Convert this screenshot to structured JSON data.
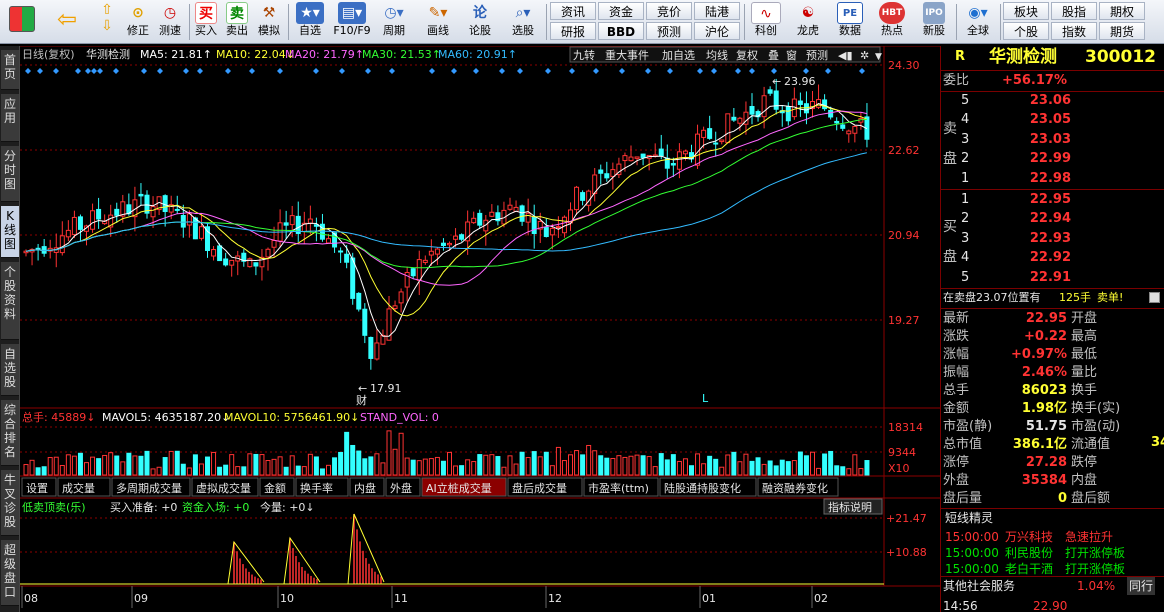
{
  "toolbar": {
    "buttons": [
      {
        "label": "修正"
      },
      {
        "label": "测速"
      },
      {
        "label": "买入"
      },
      {
        "label": "卖出"
      },
      {
        "label": "模拟"
      },
      {
        "label": "自选"
      },
      {
        "label": "F10/F9"
      },
      {
        "label": "周期"
      },
      {
        "label": "画线"
      },
      {
        "label": "论股"
      },
      {
        "label": "选股"
      },
      {
        "label": "科创"
      },
      {
        "label": "龙虎"
      },
      {
        "label": "数据"
      },
      {
        "label": "热点"
      },
      {
        "label": "新股"
      },
      {
        "label": "全球"
      }
    ],
    "grid1": [
      "资讯",
      "资金",
      "竞价",
      "陆港",
      "研报",
      "BBD",
      "预测",
      "沪伦"
    ],
    "grid2": [
      "板块",
      "股指",
      "期权",
      "个股",
      "指数",
      "期货"
    ],
    "buy_char": "买",
    "sell_char": "卖",
    "bbd": "BBD",
    "pe": "PE",
    "hbt": "HBT",
    "ipo": "IPO"
  },
  "sidetabs": [
    "首页",
    "应用",
    "分时图",
    "K线图",
    "个股资料",
    "自选股",
    "综合排名",
    "牛叉诊股",
    "超级盘口"
  ],
  "chart": {
    "header": {
      "period": "日线(复权)",
      "name": "华测检测",
      "ma5": "MA5: 21.81↑",
      "ma10": "MA10: 22.04↓",
      "ma20": "MA20: 21.79↑",
      "ma30": "MA30: 21.53↑",
      "ma60": "MA60: 20.91↑",
      "buttons": [
        "九转",
        "重大事件",
        "加自选",
        "均线",
        "复权",
        "叠",
        "窗",
        "预测"
      ]
    },
    "price_axis": [
      "24.30",
      "22.62",
      "20.94",
      "19.27"
    ],
    "high_label": "23.96",
    "low_label": "17.91",
    "fin_mark": "财",
    "l_mark": "L",
    "volume_header": {
      "total": "总手: 45889↓",
      "mavol5": "MAVOL5: 4635187.20↓",
      "mavol10": "MAVOL10: 5756461.90↓",
      "stand": "STAND_VOL: 0"
    },
    "volume_axis": [
      "18314",
      "9344",
      "X10"
    ],
    "tabs": [
      "设置",
      "成交量",
      "多周期成交量",
      "虚拟成交量",
      "金额",
      "换手率",
      "内盘",
      "外盘",
      "AI立桩成交量",
      "盘后成交量",
      "市盈率(ttm)",
      "陆股通持股变化",
      "融资融券变化"
    ],
    "active_tab": "AI立桩成交量",
    "indicator": {
      "name": "低卖顶卖(乐)",
      "buy_prep": "买入准备: +0",
      "capital": "资金入场: +0",
      "today": "今量: +0↓",
      "help": "指标说明",
      "axis": [
        "+21.47",
        "+10.88"
      ]
    },
    "months": [
      "08",
      "09",
      "10",
      "11",
      "12",
      "01",
      "02"
    ],
    "colors": {
      "up": "#ff3333",
      "down": "#33ffff",
      "ma5": "#ffffff",
      "ma10": "#ffff33",
      "ma20": "#ff66ff",
      "ma30": "#33ff33",
      "ma60": "#33bbff",
      "grid": "#8b0000"
    }
  },
  "info": {
    "r_mark": "R",
    "title": "华测检测",
    "code": "300012",
    "weibi_label": "委比",
    "weibi": "+56.17%",
    "sell_label": "卖盘",
    "buy_label": "买盘",
    "sells": [
      {
        "lvl": "5",
        "price": "23.06"
      },
      {
        "lvl": "4",
        "price": "23.05"
      },
      {
        "lvl": "3",
        "price": "23.03"
      },
      {
        "lvl": "2",
        "price": "22.99"
      },
      {
        "lvl": "1",
        "price": "22.98"
      }
    ],
    "buys": [
      {
        "lvl": "1",
        "price": "22.95"
      },
      {
        "lvl": "2",
        "price": "22.94"
      },
      {
        "lvl": "3",
        "price": "22.93"
      },
      {
        "lvl": "4",
        "price": "22.92"
      },
      {
        "lvl": "5",
        "price": "22.91"
      }
    ],
    "notice": "在卖盘23.07位置有",
    "notice_qty": "125手",
    "notice_tag": "卖单!",
    "stats": [
      {
        "l": "最新",
        "v": "22.95",
        "c": "red",
        "l2": "开盘"
      },
      {
        "l": "涨跌",
        "v": "+0.22",
        "c": "red",
        "l2": "最高"
      },
      {
        "l": "涨幅",
        "v": "+0.97%",
        "c": "red",
        "l2": "最低"
      },
      {
        "l": "振幅",
        "v": "2.46%",
        "c": "red",
        "l2": "量比"
      },
      {
        "l": "总手",
        "v": "86023",
        "c": "yel",
        "l2": "换手"
      },
      {
        "l": "金额",
        "v": "1.98亿",
        "c": "yel",
        "l2": "换手(实)"
      },
      {
        "l": "市盈(静)",
        "v": "51.75",
        "c": "wht",
        "l2": "市盈(动)"
      },
      {
        "l": "总市值",
        "v": "386.1亿",
        "c": "yel",
        "l2": "流通值"
      },
      {
        "l": "涨停",
        "v": "27.28",
        "c": "red",
        "l2": "跌停"
      },
      {
        "l": "外盘",
        "v": "35384",
        "c": "red",
        "l2": "内盘"
      },
      {
        "l": "盘后量",
        "v": "0",
        "c": "yel",
        "l2": "盘后额"
      }
    ],
    "liutong_extra": "34",
    "short_title": "短线精灵",
    "short_items": [
      {
        "time": "15:00:00",
        "name": "万兴科技",
        "event": "急速拉升",
        "c": "red"
      },
      {
        "time": "15:00:00",
        "name": "利民股份",
        "event": "打开涨停板",
        "c": "grn"
      },
      {
        "time": "15:00:00",
        "name": "老白干酒",
        "event": "打开涨停板",
        "c": "grn"
      }
    ],
    "sector_label": "其他社会服务",
    "sector_pct": "1.04%",
    "sector_more": "同行",
    "bottom_time": "14:56",
    "bottom_price": "22.90"
  }
}
